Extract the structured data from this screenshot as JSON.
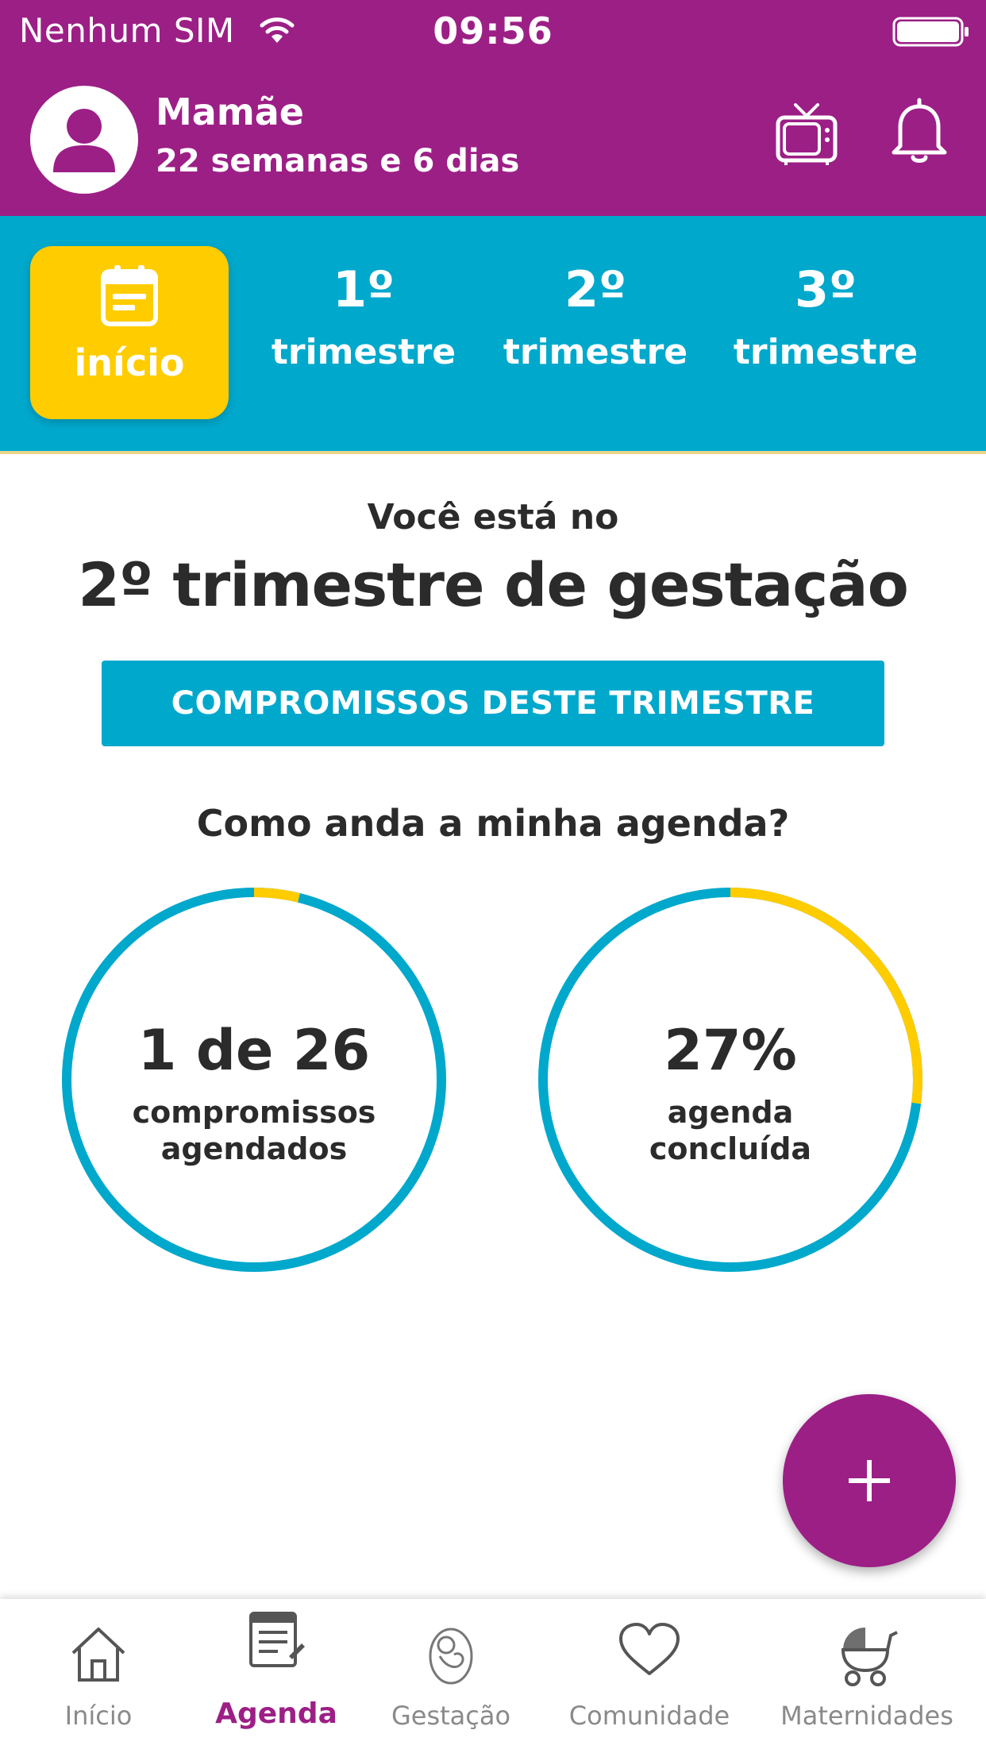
{
  "colors": {
    "brand_purple": "#9c1f86",
    "tab_blue": "#00a8cc",
    "accent_yellow": "#ffcc00"
  },
  "status_bar": {
    "carrier": "Nenhum SIM",
    "time": "09:56"
  },
  "profile": {
    "name": "Mamãe",
    "subtitle": "22 semanas e 6 dias"
  },
  "header_icons": [
    "avatar-icon",
    "tv-icon",
    "bell-icon"
  ],
  "tabs": [
    {
      "label": "início",
      "icon": "calendar-icon",
      "selected": true
    },
    {
      "number": "1º",
      "label": "trimestre"
    },
    {
      "number": "2º",
      "label": "trimestre"
    },
    {
      "number": "3º",
      "label": "trimestre"
    }
  ],
  "main": {
    "intro": "Você está no",
    "headline": "2º trimestre de gestação",
    "cta_label": "COMPROMISSOS DESTE TRIMESTRE",
    "question": "Como anda a minha agenda?"
  },
  "stats": [
    {
      "value": "1 de 26",
      "caption_line1": "compromissos",
      "caption_line2": "agendados",
      "progress": 0.0385
    },
    {
      "value": "27%",
      "caption_line1": "agenda",
      "caption_line2": "concluída",
      "progress": 0.27
    }
  ],
  "fab": {
    "icon": "plus-icon"
  },
  "bottom_nav": [
    {
      "label": "Início",
      "icon": "home-icon"
    },
    {
      "label": "Agenda",
      "icon": "agenda-icon",
      "active": true
    },
    {
      "label": "Gestação",
      "icon": "baby-icon"
    },
    {
      "label": "Comunidade",
      "icon": "heart-icon"
    },
    {
      "label": "Maternidades",
      "icon": "stroller-icon"
    }
  ]
}
